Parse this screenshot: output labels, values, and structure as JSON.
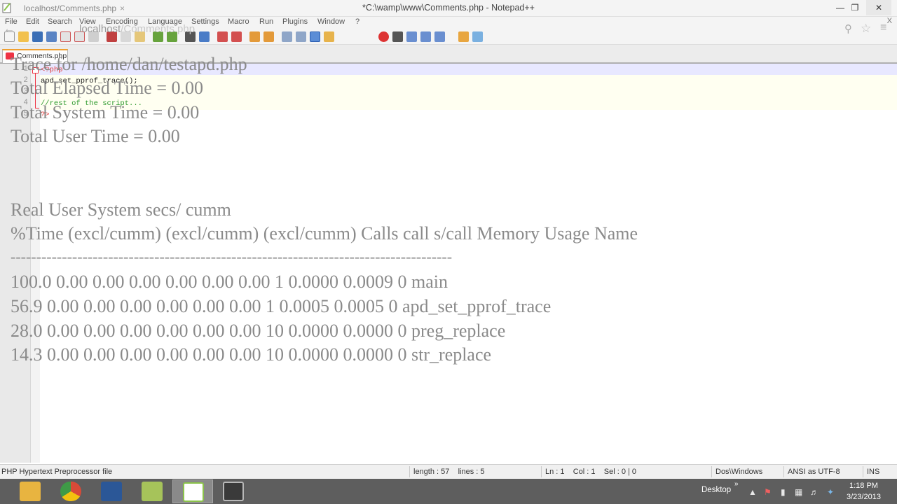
{
  "window": {
    "title": "*C:\\wamp\\www\\Comments.php - Notepad++",
    "browser_tab": "localhost/Comments.php",
    "browser_tab_close": "×",
    "min": "—",
    "restore": "❐",
    "close": "✕"
  },
  "ghost_browser": {
    "back": "←",
    "url_host": "localhost",
    "url_path": "/Comments.php",
    "search_icon": "search-icon",
    "star_icon": "star-icon",
    "menu_icon": "menu-icon"
  },
  "menu": {
    "items": [
      "File",
      "Edit",
      "Search",
      "View",
      "Encoding",
      "Language",
      "Settings",
      "Macro",
      "Run",
      "Plugins",
      "Window",
      "?"
    ],
    "close_glyph": "X"
  },
  "tabs": {
    "active": "Comments.php"
  },
  "editor": {
    "lines": [
      {
        "no": "1",
        "text": "<?php"
      },
      {
        "no": "2",
        "text": "apd_set_pprof_trace();"
      },
      {
        "no": "3",
        "text": ""
      },
      {
        "no": "4",
        "text": "//rest of the script..."
      },
      {
        "no": "5",
        "text": "?>"
      }
    ]
  },
  "trace": {
    "lines": [
      "Trace for /home/dan/testapd.php",
      "Total Elapsed Time = 0.00",
      "Total System Time = 0.00",
      "Total User Time = 0.00",
      "",
      "",
      "Real User System secs/ cumm",
      "%Time (excl/cumm) (excl/cumm) (excl/cumm) Calls call s/call Memory Usage Name",
      "--------------------------------------------------------------------------------------",
      "100.0 0.00 0.00 0.00 0.00 0.00 0.00 1 0.0000 0.0009 0 main",
      "56.9 0.00 0.00 0.00 0.00 0.00 0.00 1 0.0005 0.0005 0 apd_set_pprof_trace",
      "28.0 0.00 0.00 0.00 0.00 0.00 0.00 10 0.0000 0.0000 0 preg_replace",
      "14.3 0.00 0.00 0.00 0.00 0.00 0.00 10 0.0000 0.0000 0 str_replace"
    ]
  },
  "status": {
    "file_type": "PHP Hypertext Preprocessor file",
    "length": "length : 57    lines : 5",
    "position": "Ln : 1    Col : 1    Sel : 0 | 0",
    "eol": "Dos\\Windows",
    "encoding": "ANSI as UTF-8",
    "mode": "INS"
  },
  "taskbar": {
    "apps": [
      {
        "name": "File Explorer",
        "color": "#e8b440"
      },
      {
        "name": "Google Chrome",
        "color": "#d84a38"
      },
      {
        "name": "Microsoft Word",
        "color": "#2b5797"
      },
      {
        "name": "Sticky Notes",
        "color": "#a6c35a"
      },
      {
        "name": "Notepad++",
        "color": "#8bc34a"
      },
      {
        "name": "Camtasia Recorder",
        "color": "#3a3a3a"
      }
    ],
    "desktop": "Desktop",
    "chevron": "»",
    "time": "1:18 PM",
    "date": "3/23/2013"
  },
  "colors": {
    "accent_tab": "#f0a030",
    "taskbar": "#5e5e5e",
    "gutter": "#e9e9e9"
  }
}
